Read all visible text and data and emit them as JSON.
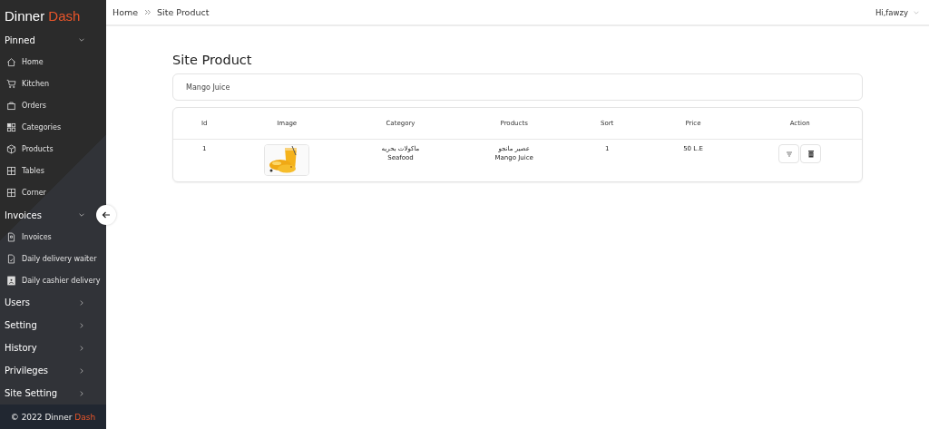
{
  "brand": {
    "name": "Dinner",
    "accent": "Dash"
  },
  "sidebar": {
    "sections": [
      {
        "label": "Pinned",
        "expanded": true,
        "items": [
          {
            "label": "Home",
            "kind": "home"
          },
          {
            "label": "Kitchen",
            "kind": "cart"
          },
          {
            "label": "Orders",
            "kind": "bag"
          },
          {
            "label": "Categories",
            "kind": "grid"
          },
          {
            "label": "Products",
            "kind": "box"
          },
          {
            "label": "Tables",
            "kind": "table"
          },
          {
            "label": "Corner",
            "kind": "table"
          }
        ]
      },
      {
        "label": "Invoices",
        "expanded": true,
        "items": [
          {
            "label": "Invoices",
            "kind": "doc"
          },
          {
            "label": "Daily delivery waiter",
            "kind": "doccheck"
          },
          {
            "label": "Daily cashier delivery",
            "kind": "badge"
          }
        ]
      },
      {
        "label": "Users",
        "expanded": false
      },
      {
        "label": "Setting",
        "expanded": false
      },
      {
        "label": "History",
        "expanded": false
      },
      {
        "label": "Privileges",
        "expanded": false
      },
      {
        "label": "Site Setting",
        "expanded": false
      }
    ]
  },
  "footer": {
    "text": "© 2022 Dinner ",
    "accent": "Dash"
  },
  "breadcrumb": [
    "Home",
    "Site Product"
  ],
  "user": {
    "greeting": "Hi,fawzy"
  },
  "page_title": "Site Product",
  "filter": {
    "value": "Mango Juice"
  },
  "table": {
    "columns": [
      "Id",
      "Image",
      "Category",
      "Products",
      "Sort",
      "Price",
      "Action"
    ],
    "rows": [
      {
        "id": "1",
        "image": {
          "kind": "picture"
        },
        "category": [
          "ماكولات بحريه",
          "Seafood"
        ],
        "product": [
          "عصير مانجو",
          "Mango Juice"
        ],
        "sort": "1",
        "price": "50 L.E"
      }
    ]
  }
}
